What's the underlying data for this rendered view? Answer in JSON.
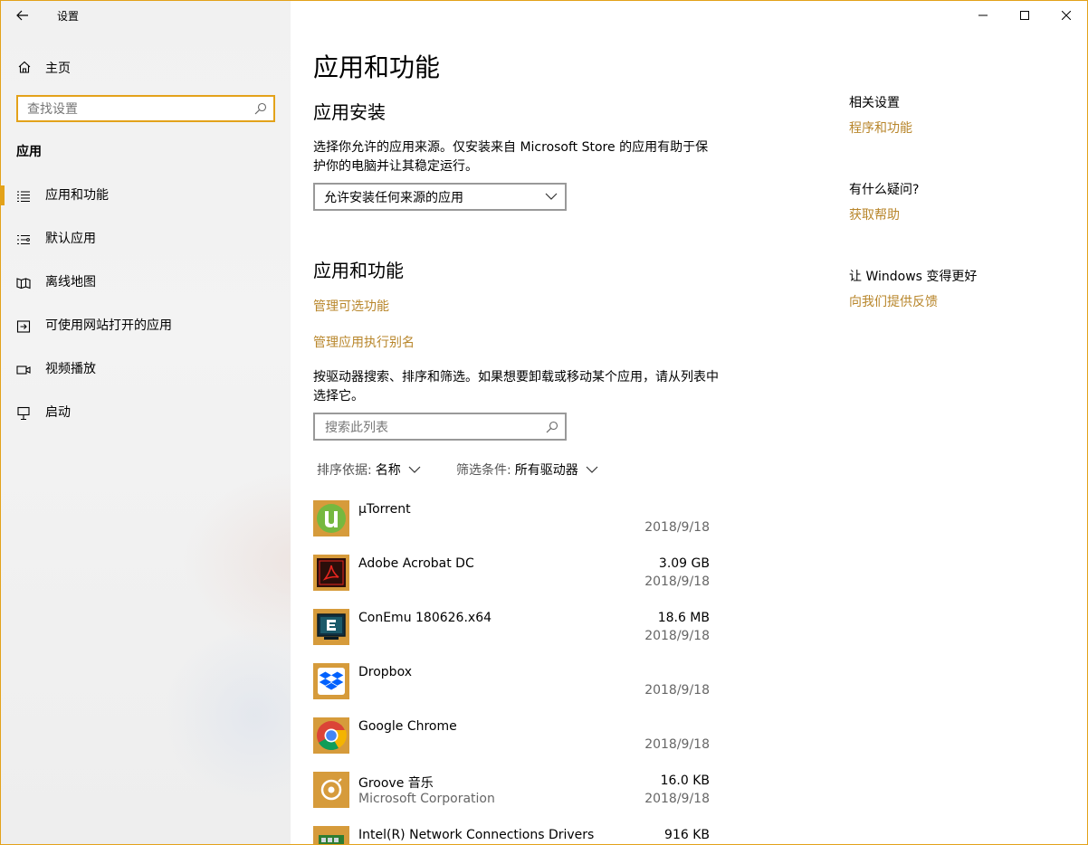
{
  "window": {
    "title": "设置"
  },
  "sidebar": {
    "home_label": "主页",
    "search": {
      "placeholder": "查找设置"
    },
    "section_label": "应用",
    "items": [
      {
        "label": "应用和功能",
        "icon": "apps-list-icon",
        "selected": true
      },
      {
        "label": "默认应用",
        "icon": "default-apps-icon",
        "selected": false
      },
      {
        "label": "离线地图",
        "icon": "offline-maps-icon",
        "selected": false
      },
      {
        "label": "可使用网站打开的应用",
        "icon": "apps-for-websites-icon",
        "selected": false
      },
      {
        "label": "视频播放",
        "icon": "video-playback-icon",
        "selected": false
      },
      {
        "label": "启动",
        "icon": "startup-icon",
        "selected": false
      }
    ]
  },
  "main": {
    "page_title": "应用和功能",
    "install_section": {
      "heading": "应用安装",
      "description": "选择你允许的应用来源。仅安装来自 Microsoft Store 的应用有助于保护你的电脑并让其稳定运行。",
      "dropdown_value": "允许安装任何来源的应用"
    },
    "features_section": {
      "heading": "应用和功能",
      "link_optional": "管理可选功能",
      "link_alias": "管理应用执行别名",
      "description": "按驱动器搜索、排序和筛选。如果想要卸载或移动某个应用，请从列表中选择它。",
      "search_placeholder": "搜索此列表",
      "sort_key": "排序依据:",
      "sort_value": "名称",
      "filter_key": "筛选条件:",
      "filter_value": "所有驱动器"
    },
    "apps": [
      {
        "name": "µTorrent",
        "publisher": "",
        "size": "",
        "date": "2018/9/18",
        "icon": "utorrent-icon"
      },
      {
        "name": "Adobe Acrobat DC",
        "publisher": "",
        "size": "3.09 GB",
        "date": "2018/9/18",
        "icon": "acrobat-icon"
      },
      {
        "name": "ConEmu 180626.x64",
        "publisher": "",
        "size": "18.6 MB",
        "date": "2018/9/18",
        "icon": "conemu-icon"
      },
      {
        "name": "Dropbox",
        "publisher": "",
        "size": "",
        "date": "2018/9/18",
        "icon": "dropbox-icon"
      },
      {
        "name": "Google Chrome",
        "publisher": "",
        "size": "",
        "date": "2018/9/18",
        "icon": "chrome-icon"
      },
      {
        "name": "Groove 音乐",
        "publisher": "Microsoft Corporation",
        "size": "16.0 KB",
        "date": "2018/9/18",
        "icon": "groove-music-icon"
      },
      {
        "name": "Intel(R) Network Connections Drivers",
        "publisher": "",
        "size": "916 KB",
        "date": "",
        "icon": "intel-network-icon"
      }
    ]
  },
  "related": {
    "heading": "相关设置",
    "link": "程序和功能",
    "question_heading": "有什么疑问?",
    "help_link": "获取帮助",
    "improve_heading": "让 Windows 变得更好",
    "feedback_link": "向我们提供反馈"
  },
  "colors": {
    "accent": "#e3a21a",
    "link": "#b8862b",
    "icon_bg": "#d69b3b"
  }
}
